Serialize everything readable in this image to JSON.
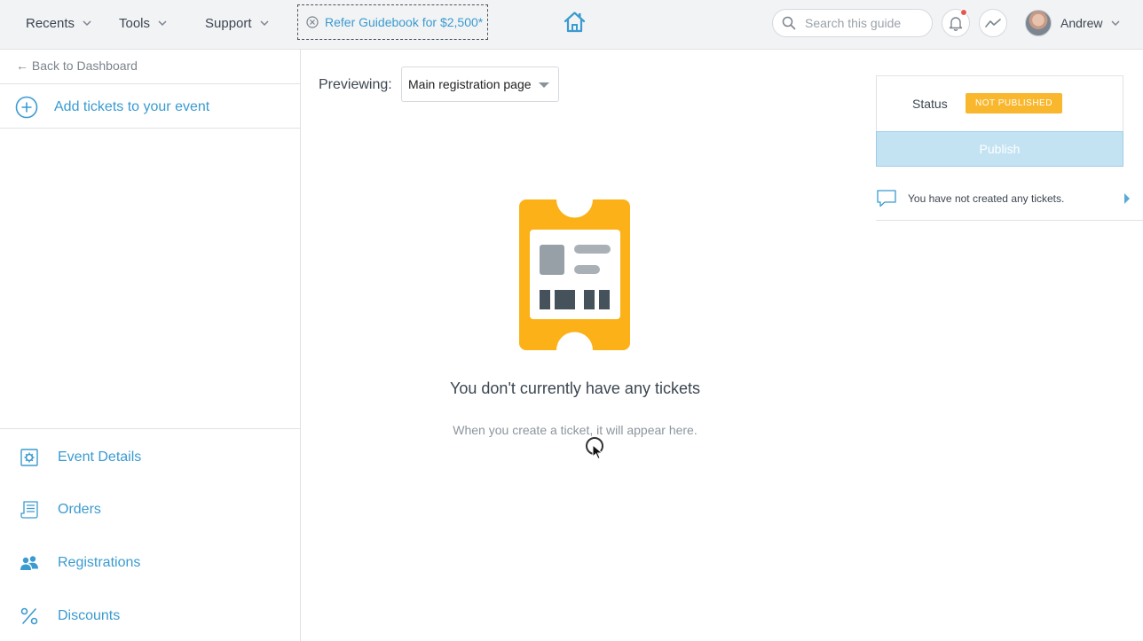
{
  "header": {
    "nav": [
      {
        "label": "Recents"
      },
      {
        "label": "Tools"
      },
      {
        "label": "Support"
      }
    ],
    "refer_label": "Refer Guidebook for $2,500*",
    "search_placeholder": "Search this guide",
    "user_name": "Andrew"
  },
  "sidebar": {
    "back_label": "Back to Dashboard",
    "add_tickets_label": "Add tickets to your event",
    "items": [
      {
        "label": "Event Details",
        "icon": "event-details-icon"
      },
      {
        "label": "Orders",
        "icon": "receipt-icon"
      },
      {
        "label": "Registrations",
        "icon": "people-icon"
      },
      {
        "label": "Discounts",
        "icon": "percent-icon"
      }
    ]
  },
  "main": {
    "previewing_label": "Previewing:",
    "preview_selected": "Main registration page",
    "empty_title": "You don't currently have any tickets",
    "empty_subtitle": "When you create a ticket, it will appear here."
  },
  "right_panel": {
    "status_label": "Status",
    "status_value": "NOT PUBLISHED",
    "publish_label": "Publish",
    "notice_text": "You have not created any tickets."
  },
  "colors": {
    "accent": "#3a9bd0",
    "badge": "#f9b72e",
    "ticket": "#fbb117",
    "publish_disabled": "#c3e3f3"
  }
}
